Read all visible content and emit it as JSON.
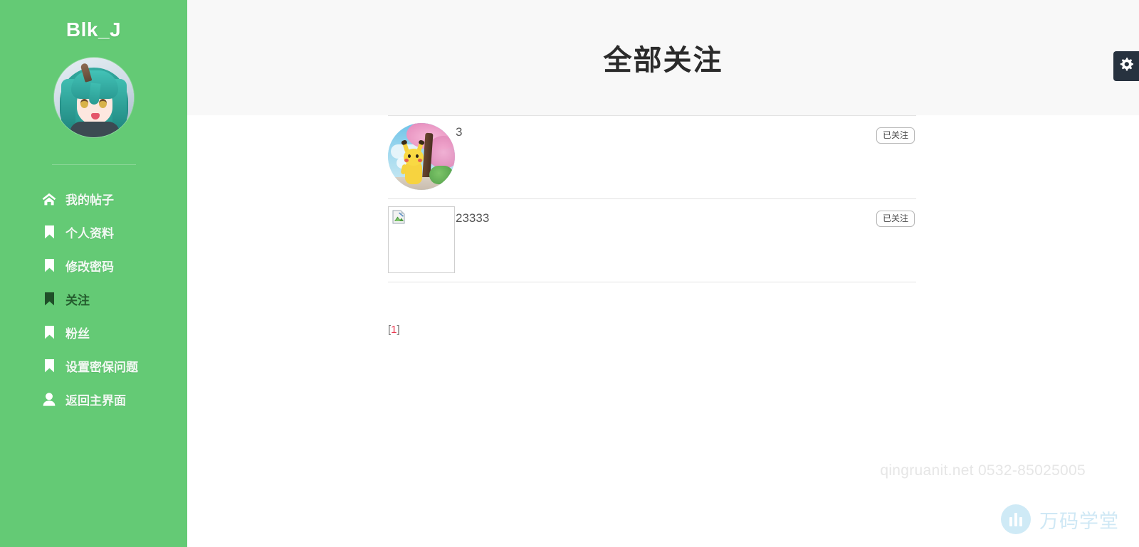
{
  "sidebar": {
    "brand": "Blk_J",
    "avatar_name": "user-avatar-anime",
    "items": [
      {
        "label": "我的帖子",
        "icon": "home-icon",
        "active": false
      },
      {
        "label": "个人资料",
        "icon": "bookmark-icon",
        "active": false
      },
      {
        "label": "修改密码",
        "icon": "bookmark-icon",
        "active": false
      },
      {
        "label": "关注",
        "icon": "bookmark-icon",
        "active": true
      },
      {
        "label": "粉丝",
        "icon": "bookmark-icon",
        "active": false
      },
      {
        "label": "设置密保问题",
        "icon": "bookmark-icon",
        "active": false
      },
      {
        "label": "返回主界面",
        "icon": "user-icon",
        "active": false
      }
    ],
    "background_color": "#64ca75",
    "active_text_color": "#245c2d"
  },
  "header": {
    "title": "全部关注",
    "background_color": "#f8f8f8",
    "settings_icon": "gear-icon",
    "settings_bg_color": "#27323f"
  },
  "follow_list": {
    "rows": [
      {
        "username": "3",
        "avatar_type": "image",
        "avatar_alt": "pikachu-sakura-avatar",
        "button_label": "已关注"
      },
      {
        "username": "23333",
        "avatar_type": "broken",
        "avatar_alt": "broken-image-placeholder",
        "button_label": "已关注"
      }
    ]
  },
  "pagination": {
    "open_bracket": "[",
    "current_page": "1",
    "close_bracket": "]",
    "current_color": "#e8384f"
  },
  "footer": {
    "watermark": "qingruanit.net 0532-85025005",
    "brand_text": "万码学堂",
    "brand_color": "#cfe8f5"
  }
}
